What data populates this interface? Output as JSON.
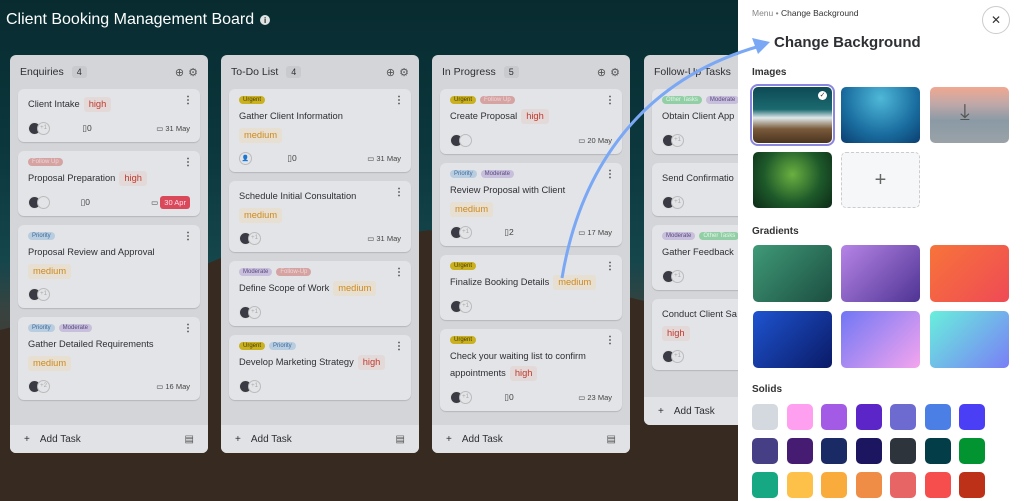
{
  "header": {
    "title": "Client Booking Management Board",
    "info_icon": "info-icon"
  },
  "tag_colors": {
    "Urgent": [
      "#c9b122",
      "#4a3d00"
    ],
    "Follow Up": [
      "#d6a3a3",
      "#efd5d5"
    ],
    "Follow-Up": [
      "#d6a3a3",
      "#efd5d5"
    ],
    "Priority": [
      "#b9cde0",
      "#3b6a99"
    ],
    "Moderate": [
      "#c8bfdc",
      "#5a4a80"
    ],
    "Other Tasks": [
      "#93cfa6",
      "#e2f4e8"
    ]
  },
  "columns": [
    {
      "name": "Enquiries",
      "count": "4",
      "cards": [
        {
          "tags": [],
          "title": "Client Intake",
          "priority": "high",
          "inline": true,
          "extra": "+1",
          "attachments": "0",
          "date": "31 May"
        },
        {
          "tags": [
            "Follow Up"
          ],
          "title": "Proposal Preparation",
          "priority": "high",
          "inline": true,
          "extra": "",
          "attachments": "0",
          "date": "30 Apr",
          "overdue": true
        },
        {
          "tags": [
            "Priority"
          ],
          "title": "Proposal Review and Approval",
          "priority": "medium",
          "inline": false,
          "extra": "+1"
        },
        {
          "tags": [
            "Priority",
            "Moderate"
          ],
          "title": "Gather Detailed Requirements",
          "priority": "medium",
          "inline": false,
          "extra": "+2",
          "date": "16 May"
        }
      ]
    },
    {
      "name": "To-Do List",
      "count": "4",
      "cards": [
        {
          "tags": [
            "Urgent"
          ],
          "title": "Gather Client Information",
          "priority": "medium",
          "inline": false,
          "placeholder": true,
          "attachments": "0",
          "date": "31 May"
        },
        {
          "tags": [],
          "title": "Schedule Initial Consultation",
          "priority": "medium",
          "inline": false,
          "extra": "+1",
          "date": "31 May"
        },
        {
          "tags": [
            "Moderate",
            "Follow-Up"
          ],
          "title": "Define Scope of Work",
          "priority": "medium",
          "inline": true,
          "extra": "+1"
        },
        {
          "tags": [
            "Urgent",
            "Priority"
          ],
          "title": "Develop Marketing Strategy",
          "priority": "high",
          "inline": true,
          "extra": "+1"
        }
      ]
    },
    {
      "name": "In Progress",
      "count": "5",
      "cards": [
        {
          "tags": [
            "Urgent",
            "Follow Up"
          ],
          "title": "Create Proposal",
          "priority": "high",
          "inline": true,
          "extra": "",
          "date": "20 May"
        },
        {
          "tags": [
            "Priority",
            "Moderate"
          ],
          "title": "Review Proposal with Client",
          "priority": "medium",
          "inline": false,
          "extra": "+1",
          "attachments": "2",
          "date": "17 May"
        },
        {
          "tags": [
            "Urgent"
          ],
          "title": "Finalize Booking Details",
          "priority": "medium",
          "inline": true,
          "extra": "+1"
        },
        {
          "tags": [
            "Urgent"
          ],
          "title": "Check your waiting list to confirm appointments",
          "priority": "high",
          "inline": true,
          "extra": "+1",
          "attachments": "0",
          "date": "23 May"
        }
      ]
    },
    {
      "name": "Follow-Up Tasks",
      "count": "",
      "cards": [
        {
          "tags": [
            "Other Tasks",
            "Moderate"
          ],
          "title": "Obtain Client App",
          "extra": "+1"
        },
        {
          "tags": [],
          "title": "Send Confirmatio",
          "extra": "+1"
        },
        {
          "tags": [
            "Moderate",
            "Other Tasks"
          ],
          "title": "Gather Feedback",
          "extra": "+1"
        },
        {
          "tags": [],
          "title": "Conduct Client Sa",
          "priority": "high",
          "inline": false,
          "extra": "+1"
        }
      ]
    }
  ],
  "add_task_label": "Add Task",
  "panel": {
    "breadcrumb": {
      "root": "Menu",
      "current": "Change Background"
    },
    "title": "Change Background",
    "images_label": "Images",
    "gradients_label": "Gradients",
    "solids_label": "Solids",
    "images": [
      {
        "name": "mountains",
        "bg": "linear-gradient(180deg,#0d4a55 0%,#1b6a70 40%,#dfe8ea 55%,#7a5a3a 75%,#4a3420 100%)",
        "selected": true
      },
      {
        "name": "underwater",
        "bg": "radial-gradient(circle at 50% 20%,#4fb8d8,#1a6ea0 60%,#0b3e70)"
      },
      {
        "name": "misty-sunset",
        "bg": "linear-gradient(180deg,#f0a890 0%,#c0a8a8 30%,#8a9aa5 60%,#9aa2a8 100%)",
        "download": true
      },
      {
        "name": "ferns",
        "bg": "radial-gradient(circle at 50% 40%,#6ab040,#1e5a2a 55%,#0c2a18)"
      }
    ],
    "gradients": [
      "linear-gradient(135deg,#3f9a78,#1c4e40)",
      "linear-gradient(135deg,#b684e6,#4e3494)",
      "linear-gradient(135deg,#f7743a,#ef4a55)",
      "linear-gradient(135deg,#1e54d0,#0a1a66)",
      "linear-gradient(135deg,#6f76f5,#f5a5ee)",
      "linear-gradient(135deg,#68f0dc,#7a7ef6)"
    ],
    "solids": [
      "#d3d9df",
      "#ff9ff0",
      "#a35be6",
      "#5c25c8",
      "#6e6bd0",
      "#4c7fe6",
      "#4a3ff5",
      "#463f86",
      "#451c72",
      "#1a2a64",
      "#1c1660",
      "#2e343c",
      "#033d48",
      "#039432",
      "#16a883",
      "#fdc14a",
      "#f9ab3b",
      "#ef8c45",
      "#e86565",
      "#f64d4d",
      "#bc3118"
    ]
  }
}
